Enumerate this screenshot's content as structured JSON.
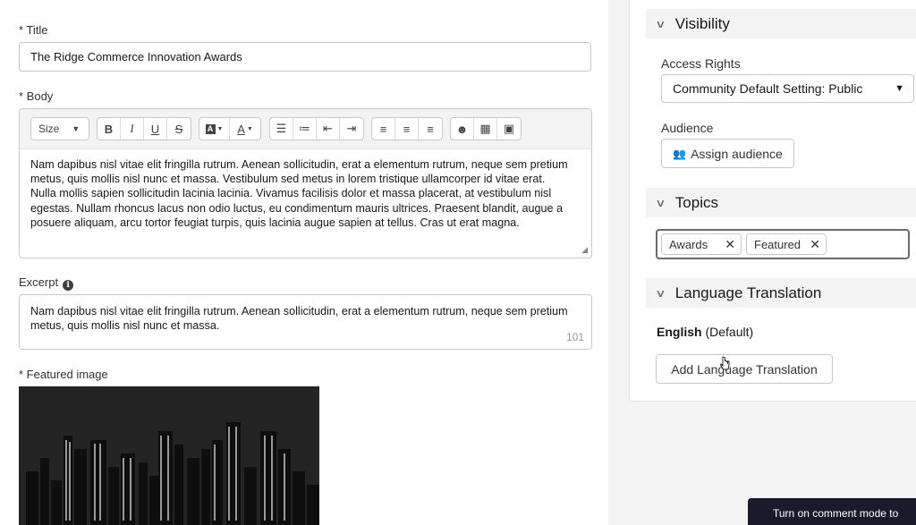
{
  "form": {
    "title_label": "Title",
    "title_value": "The Ridge Commerce Innovation Awards",
    "body_label": "Body",
    "toolbar": {
      "size_label": "Size"
    },
    "body_text": "Nam dapibus nisl vitae elit fringilla rutrum. Aenean sollicitudin, erat a elementum rutrum, neque sem pretium metus, quis mollis nisl nunc et massa. Vestibulum sed metus in lorem tristique ullamcorper id vitae erat. Nulla mollis sapien sollicitudin lacinia lacinia. Vivamus facilisis dolor et massa placerat, at vestibulum nisl egestas. Nullam rhoncus lacus non odio luctus, eu condimentum mauris ultrices. Praesent blandit, augue a posuere aliquam, arcu tortor feugiat turpis, quis lacinia augue sapien at tellus. Cras ut erat magna.",
    "excerpt_label": "Excerpt",
    "excerpt_text": "Nam dapibus nisl vitae elit fringilla rutrum. Aenean sollicitudin, erat a elementum rutrum, neque sem pretium metus, quis mollis nisl nunc et massa.",
    "excerpt_count": "101",
    "featured_image_label": "Featured image"
  },
  "sidebar": {
    "visibility": {
      "heading": "Visibility",
      "access_rights_label": "Access Rights",
      "access_rights_value": "Community Default Setting: Public",
      "audience_label": "Audience",
      "assign_audience_button": "Assign audience"
    },
    "topics": {
      "heading": "Topics",
      "pills": [
        "Awards",
        "Featured"
      ]
    },
    "language": {
      "heading": "Language Translation",
      "default_language": "English",
      "default_suffix": "(Default)",
      "add_button": "Add Language Translation"
    }
  },
  "toast": {
    "text": "Turn on comment mode to"
  },
  "colors": {
    "toast_bg": "#1a1a2a",
    "section_bg": "#f3f3f3",
    "border": "#c9c9c9"
  }
}
